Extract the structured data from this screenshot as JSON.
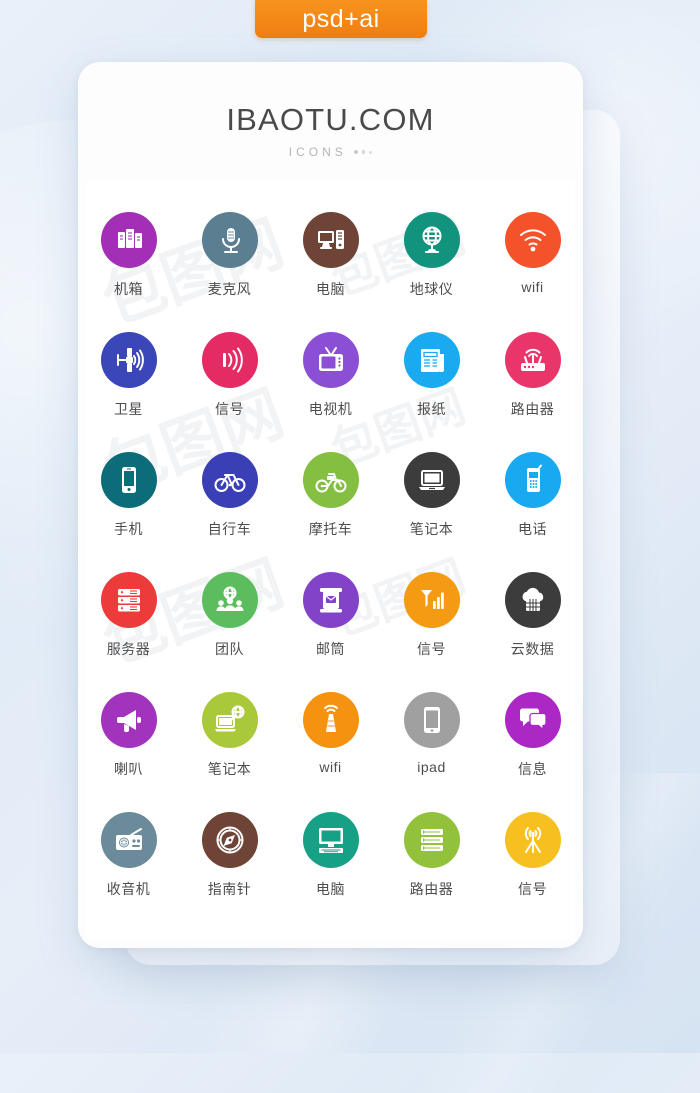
{
  "badge": {
    "label": "psd+ai",
    "color": "#f7941e"
  },
  "card": {
    "title": "IBAOTU.COM",
    "subtitle": "ICONS"
  },
  "watermarks": [
    "包图网",
    "包图网",
    "包图网",
    "包图网",
    "包图网",
    "包图网"
  ],
  "icons": [
    {
      "label": "机箱",
      "icon": "server-tower-icon",
      "color": "#a22fb5"
    },
    {
      "label": "麦克风",
      "icon": "microphone-icon",
      "color": "#5c7e91"
    },
    {
      "label": "电脑",
      "icon": "desktop-computer-icon",
      "color": "#6d4436"
    },
    {
      "label": "地球仪",
      "icon": "globe-stand-icon",
      "color": "#12937d"
    },
    {
      "label": "wifi",
      "icon": "wifi-icon",
      "color": "#f4522a"
    },
    {
      "label": "卫星",
      "icon": "satellite-icon",
      "color": "#3b46b8"
    },
    {
      "label": "信号",
      "icon": "signal-waves-icon",
      "color": "#e52b64"
    },
    {
      "label": "电视机",
      "icon": "television-icon",
      "color": "#8a4fd4"
    },
    {
      "label": "报纸",
      "icon": "newspaper-icon",
      "color": "#19aaf0"
    },
    {
      "label": "路由器",
      "icon": "router-icon",
      "color": "#e8366b"
    },
    {
      "label": "手机",
      "icon": "smartphone-icon",
      "color": "#0c6d78"
    },
    {
      "label": "自行车",
      "icon": "bicycle-icon",
      "color": "#3a3fb5"
    },
    {
      "label": "摩托车",
      "icon": "motorcycle-icon",
      "color": "#84bf41"
    },
    {
      "label": "笔记本",
      "icon": "laptop-icon",
      "color": "#3c3c3c"
    },
    {
      "label": "电话",
      "icon": "cellphone-icon",
      "color": "#18a9f0"
    },
    {
      "label": "服务器",
      "icon": "server-rack-icon",
      "color": "#ed3b3b"
    },
    {
      "label": "团队",
      "icon": "team-globe-icon",
      "color": "#5bbd5e"
    },
    {
      "label": "邮筒",
      "icon": "mailbox-icon",
      "color": "#8243c9"
    },
    {
      "label": "信号",
      "icon": "signal-bars-icon",
      "color": "#f59a13"
    },
    {
      "label": "云数据",
      "icon": "cloud-data-icon",
      "color": "#3c3c3c"
    },
    {
      "label": "喇叭",
      "icon": "megaphone-icon",
      "color": "#a233bd"
    },
    {
      "label": "笔记本",
      "icon": "laptop-network-icon",
      "color": "#a9c93a"
    },
    {
      "label": "wifi",
      "icon": "signal-tower-icon",
      "color": "#f59210"
    },
    {
      "label": "ipad",
      "icon": "tablet-icon",
      "color": "#a0a0a0"
    },
    {
      "label": "信息",
      "icon": "chat-bubbles-icon",
      "color": "#ab28c4"
    },
    {
      "label": "收音机",
      "icon": "radio-icon",
      "color": "#6b8b9b"
    },
    {
      "label": "指南针",
      "icon": "compass-icon",
      "color": "#6d4436"
    },
    {
      "label": "电脑",
      "icon": "monitor-keyboard-icon",
      "color": "#16a085"
    },
    {
      "label": "路由器",
      "icon": "server-stack-icon",
      "color": "#92c23c"
    },
    {
      "label": "信号",
      "icon": "antenna-icon",
      "color": "#f6c020"
    }
  ]
}
